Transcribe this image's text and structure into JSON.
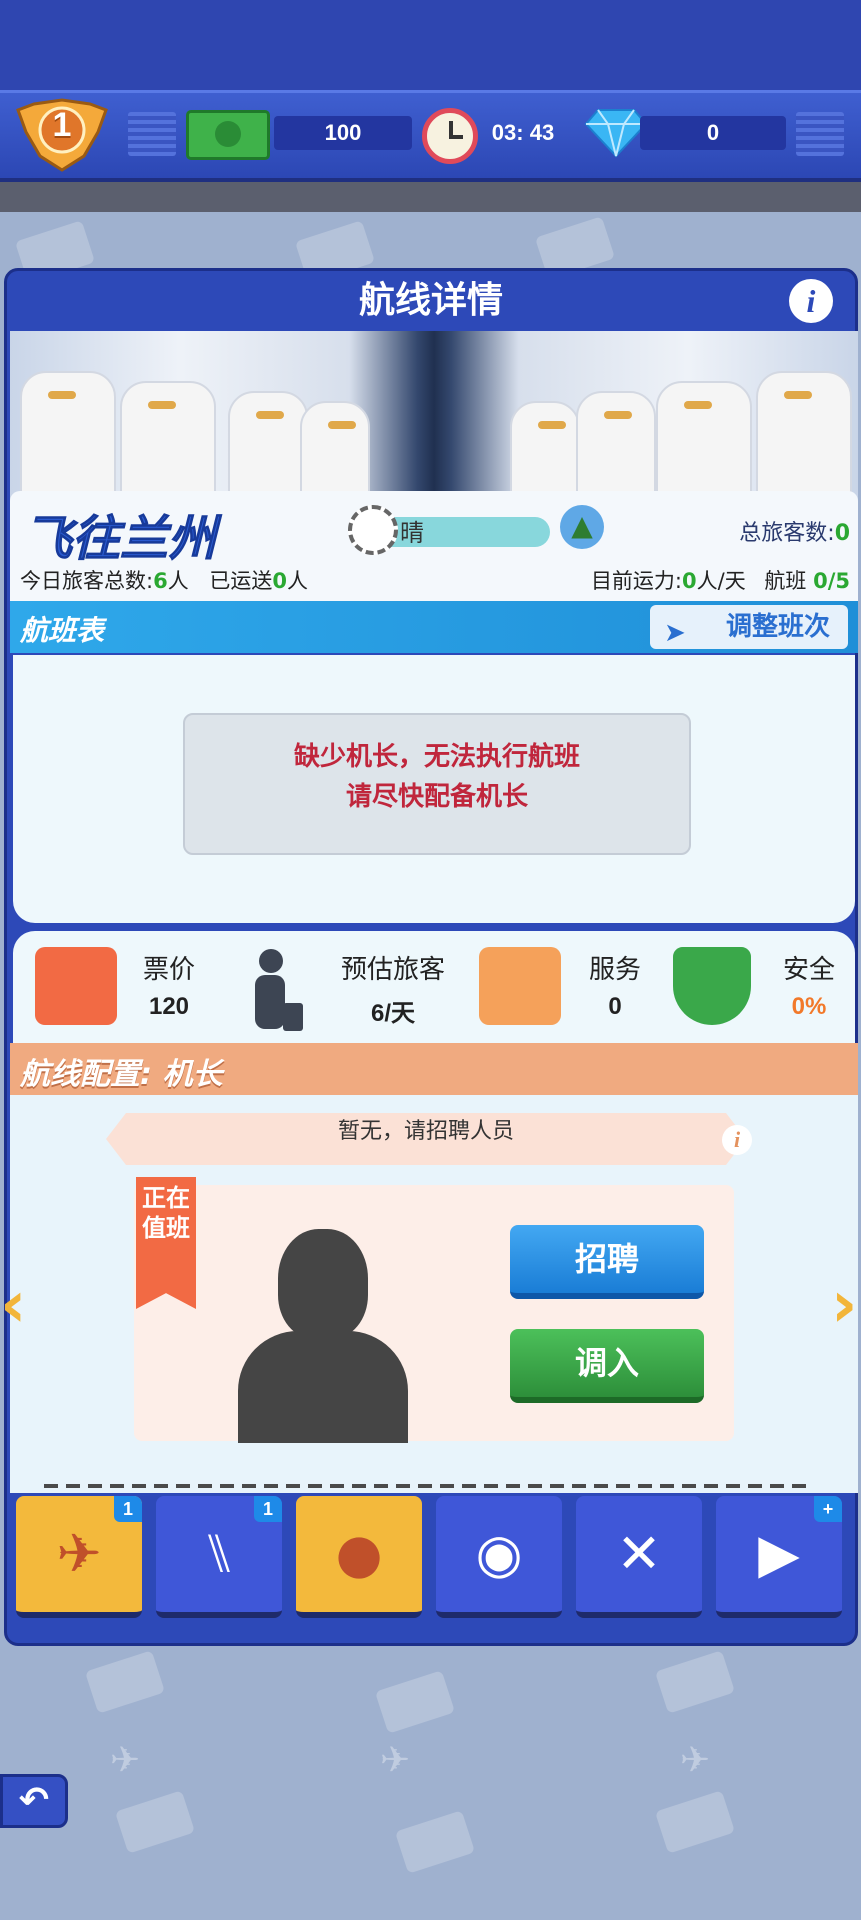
{
  "hud": {
    "level": "1",
    "cash": "100",
    "timer": "03: 43",
    "gems": "0"
  },
  "panel": {
    "title": "航线详情",
    "info_glyph": "i"
  },
  "route": {
    "destination": "飞往兰州",
    "weather": "晴",
    "total_passengers_label": "总旅客数:",
    "total_passengers_value": "0",
    "today_label": "今日旅客总数:",
    "today_value": "6",
    "today_unit": "人",
    "shipped_label": "已运送",
    "shipped_value": "0",
    "shipped_unit": "人",
    "capacity_label": "目前运力:",
    "capacity_value": "0",
    "capacity_unit": "人/天",
    "flights_label": "航班",
    "flights_value": "0/5"
  },
  "schedule": {
    "title": "航班表",
    "adjust_label": "调整班次",
    "warning_line1": "缺少机长，无法执行航班",
    "warning_line2": "请尽快配备机长"
  },
  "stats": {
    "ticket_label": "票价",
    "ticket_value": "120",
    "est_label": "预估旅客",
    "est_value": "6/天",
    "service_label": "服务",
    "service_value": "0",
    "safety_label": "安全",
    "safety_value": "0%"
  },
  "config": {
    "title": "航线配置: 机长",
    "notice": "暂无，请招聘人员",
    "duty_label": "正在值班",
    "hire_label": "招聘",
    "transfer_label": "调入"
  },
  "slots": [
    {
      "icon": "airplane-icon",
      "badge": "1"
    },
    {
      "icon": "seat-icon",
      "badge": "1"
    },
    {
      "icon": "captain-icon",
      "badge": ""
    },
    {
      "icon": "ground-crew-icon",
      "badge": ""
    },
    {
      "icon": "dining-icon",
      "badge": ""
    },
    {
      "icon": "entertainment-icon",
      "badge": "+"
    }
  ],
  "colors": {
    "accent_blue": "#2d49b8",
    "warning_red": "#c0263c",
    "safety_orange": "#f26a44",
    "highlight_green": "#2aa832"
  }
}
